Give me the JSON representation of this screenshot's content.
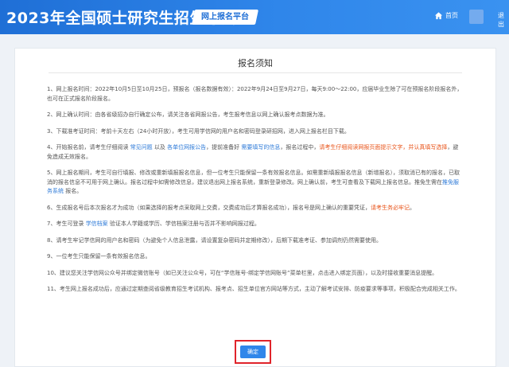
{
  "header": {
    "title": "2023年全国硕士研究生招生考试",
    "platform_tag": "网上报名平台",
    "home_label": "首页",
    "exit_label": "退出"
  },
  "notice": {
    "title": "报名须知",
    "items": [
      [
        {
          "t": "1、网上报名时间：2022年10月5日至10月25日，预报名（报名数据有效）：2022年9月24日至9月27日，每天9:00～22:00，应届毕业生除了可在预报名阶段报名外，也可在正式报名阶段报名。"
        }
      ],
      [
        {
          "t": "2、网上确认时间：由各省级招办自行确定公布，请关注各省网报公告，考生报考信息以网上确认报考点数据为准。"
        }
      ],
      [
        {
          "t": "3、下载准考证时间：考前十天左右（24小时开放），考生可用学信网的用户名和密码登录研招网，进入网上报名栏目下载。"
        }
      ],
      [
        {
          "t": "4、开始报名前，请考生仔细阅读 "
        },
        {
          "t": "常见问题",
          "c": "blue"
        },
        {
          "t": " 以及 "
        },
        {
          "t": "各单位网报公告",
          "c": "blue"
        },
        {
          "t": "，提前准备好 "
        },
        {
          "t": "需要填写的信息",
          "c": "blue"
        },
        {
          "t": "，报名过程中，"
        },
        {
          "t": "请考生仔细阅读网报页面提示文字，并认真填写选择",
          "c": "red"
        },
        {
          "t": "，避免造成无效报名。"
        }
      ],
      [
        {
          "t": "5、网上报名期间，考生可自行填报、修改或重新填报报名信息，但一位考生只能保留一条有效报名信息。如需重新填报报名信息（新增报名），须取消已有的报名，已取消的报名信息不可用于网上确认。报名过程中如需修改信息，建议退出网上报名系统，重新登录修改。网上确认前，考生可查看及下载网上报名信息。推免生需在"
        },
        {
          "t": "推免服务系统",
          "c": "blue"
        },
        {
          "t": " 报名。"
        }
      ],
      [
        {
          "t": "6、生成报名号后本次报名才为成功（如果选择的报考点采取网上交费，交费成功后才算报名成功），报名号是网上确认的重要凭证，"
        },
        {
          "t": "请考生务必牢记",
          "c": "red"
        },
        {
          "t": "。"
        }
      ],
      [
        {
          "t": "7、考生可登录 "
        },
        {
          "t": "学信档案",
          "c": "blue"
        },
        {
          "t": " 验证本人学籍或学历、学信档案注册与否并不影响网报过程。"
        }
      ],
      [
        {
          "t": "8、请考生牢记学信网的用户名和密码（为避免个人信息泄露，请设置复杂密码并定期修改），后期下载准考证、参加调剂仍然需要使用。"
        }
      ],
      [
        {
          "t": "9、一位考生只能保留一条有效报名信息。"
        }
      ],
      [
        {
          "t": "10、建议您关注学信网公众号并绑定微信账号（如已关注公众号，可在“学信账号-绑定学信网账号”菜单栏里，点击进入绑定页面），以及时接收重要消息提醒。"
        }
      ],
      [
        {
          "t": "11、考生网上报名成功后，应通过定期查阅省级教育招生考试机构、报考点、招生单位官方网站等方式，主动了解考试安排、防疫要求等事项，积极配合完成相关工作。"
        }
      ]
    ]
  },
  "confirm_button": {
    "label": "确定"
  },
  "colors": {
    "header_blue": "#2f86ea",
    "link_blue": "#2f7bd8",
    "warning_orange": "#e8541a",
    "highlight_red": "#e0242b"
  }
}
